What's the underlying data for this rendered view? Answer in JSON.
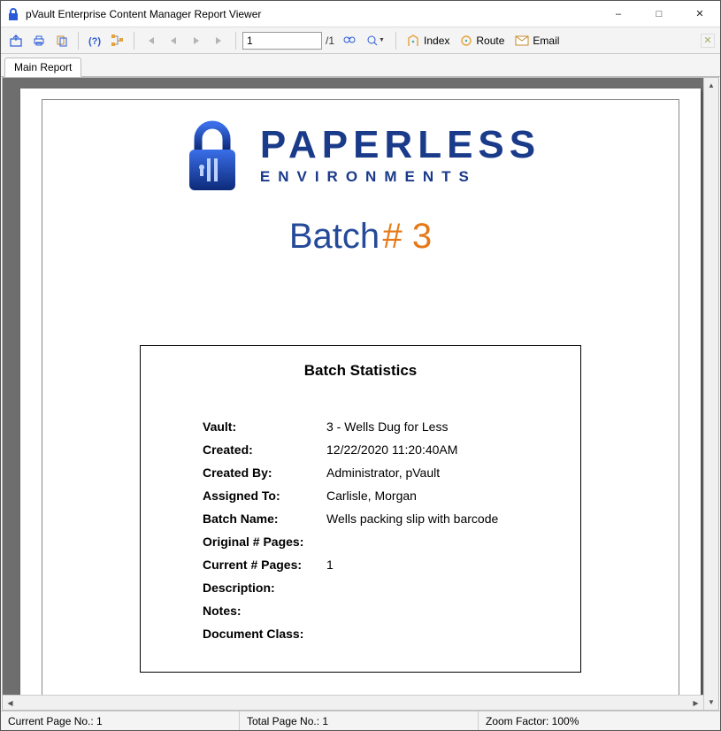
{
  "window": {
    "title": "pVault Enterprise Content Manager Report Viewer"
  },
  "toolbar": {
    "page_input_value": "1",
    "page_total_label": "/1",
    "index_label": "Index",
    "route_label": "Route",
    "email_label": "Email"
  },
  "tab": {
    "main_label": "Main Report"
  },
  "logo": {
    "brand_top": "PAPERLESS",
    "brand_sub": "ENVIRONMENTS"
  },
  "batch": {
    "word": "Batch",
    "hash_and_number": "# 3"
  },
  "stats": {
    "heading": "Batch Statistics",
    "rows": {
      "vault": {
        "label": "Vault:",
        "value": "3 - Wells Dug for Less"
      },
      "created": {
        "label": "Created:",
        "value": "12/22/2020   11:20:40AM"
      },
      "created_by": {
        "label": "Created By:",
        "value": "Administrator, pVault"
      },
      "assigned_to": {
        "label": "Assigned To:",
        "value": "Carlisle, Morgan"
      },
      "batch_name": {
        "label": "Batch Name:",
        "value": "Wells packing slip with barcode"
      },
      "original_pages": {
        "label": "Original # Pages:",
        "value": ""
      },
      "current_pages": {
        "label": "Current # Pages:",
        "value": "1"
      },
      "description": {
        "label": "Description:",
        "value": ""
      },
      "notes": {
        "label": "Notes:",
        "value": ""
      },
      "document_class": {
        "label": "Document Class:",
        "value": ""
      }
    }
  },
  "status": {
    "current_page": "Current Page No.: 1",
    "total_page": "Total Page No.: 1",
    "zoom": "Zoom Factor: 100%"
  }
}
